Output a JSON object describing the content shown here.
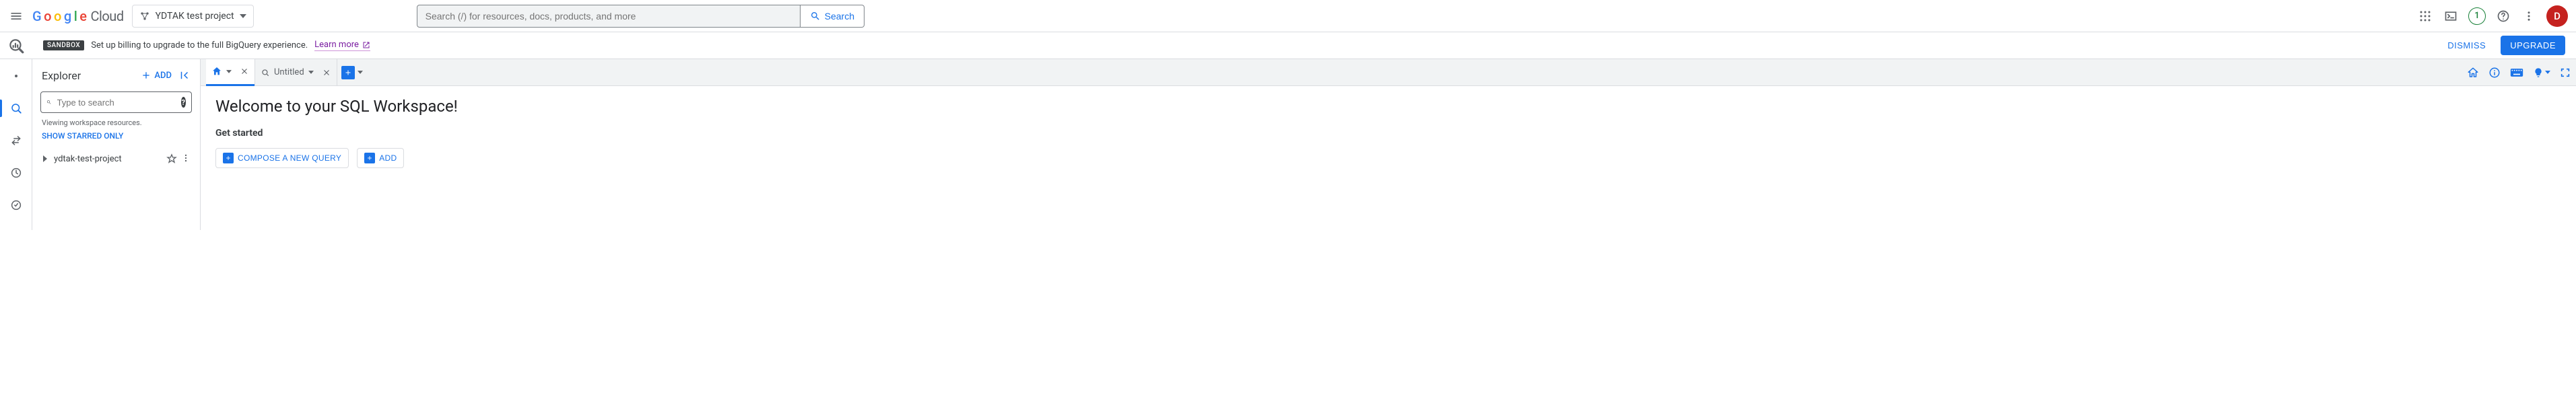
{
  "header": {
    "logo_cloud": "Cloud",
    "project_name": "YDTAK test project",
    "search_placeholder": "Search (/) for resources, docs, products, and more",
    "search_button": "Search",
    "trial_count": "1",
    "avatar_initial": "D"
  },
  "banner": {
    "badge": "SANDBOX",
    "text": "Set up billing to upgrade to the full BigQuery experience.",
    "learn_more": "Learn more",
    "dismiss": "DISMISS",
    "upgrade": "UPGRADE"
  },
  "explorer": {
    "title": "Explorer",
    "add": "ADD",
    "search_placeholder": "Type to search",
    "workspace_note": "Viewing workspace resources.",
    "show_starred": "SHOW STARRED ONLY",
    "project_node": "ydtak-test-project"
  },
  "tabs": {
    "untitled": "Untitled"
  },
  "workspace": {
    "welcome_title": "Welcome to your SQL Workspace!",
    "get_started": "Get started",
    "compose_query": "COMPOSE A NEW QUERY",
    "add": "ADD"
  }
}
